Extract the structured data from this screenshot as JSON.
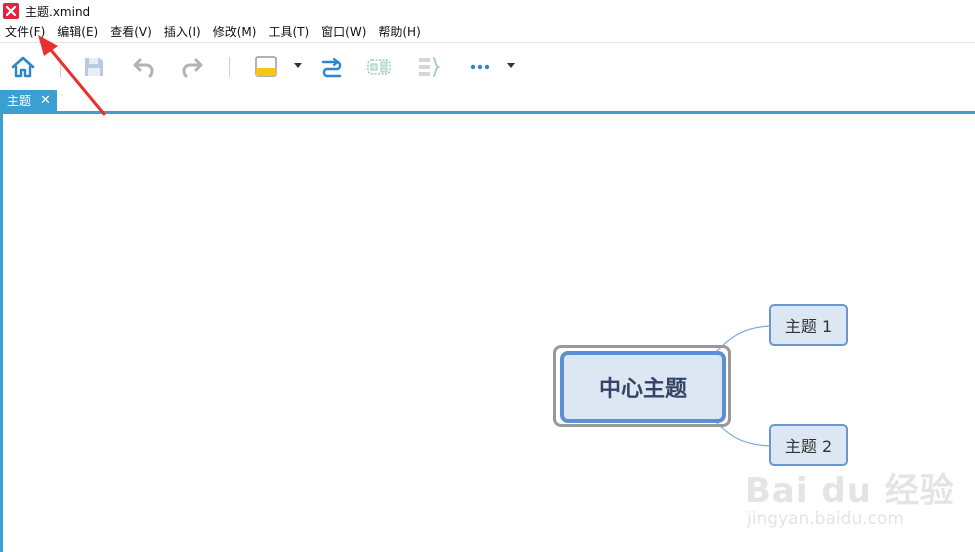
{
  "window": {
    "title": "主题.xmind"
  },
  "menu": [
    {
      "key": "file",
      "label": "文件(F)"
    },
    {
      "key": "edit",
      "label": "编辑(E)"
    },
    {
      "key": "view",
      "label": "查看(V)"
    },
    {
      "key": "insert",
      "label": "插入(I)"
    },
    {
      "key": "modify",
      "label": "修改(M)"
    },
    {
      "key": "tools",
      "label": "工具(T)"
    },
    {
      "key": "window",
      "label": "窗口(W)"
    },
    {
      "key": "help",
      "label": "帮助(H)"
    }
  ],
  "toolbar": {
    "icons": [
      "home-icon",
      "save-icon",
      "undo-icon",
      "redo-icon",
      "topic-style-icon",
      "relationship-icon",
      "boundary-icon",
      "summary-icon",
      "more-icon"
    ],
    "colors": {
      "home": "#2a86d1",
      "style_fill": "#f5c518",
      "relationship": "#2a86d1",
      "boundary": "#9ccfb7"
    }
  },
  "tabs": [
    {
      "label": "主题",
      "active": true
    }
  ],
  "mindmap": {
    "central": {
      "label": "中心主题"
    },
    "topics": [
      {
        "label": "主题 1"
      },
      {
        "label": "主题 2"
      }
    ],
    "colors": {
      "fill": "#dde6f3",
      "border": "#5b8fd1",
      "connector": "#7ea6d8"
    }
  },
  "watermark": {
    "main": "Bai du 经验",
    "sub": "jingyan.baidu.com"
  }
}
